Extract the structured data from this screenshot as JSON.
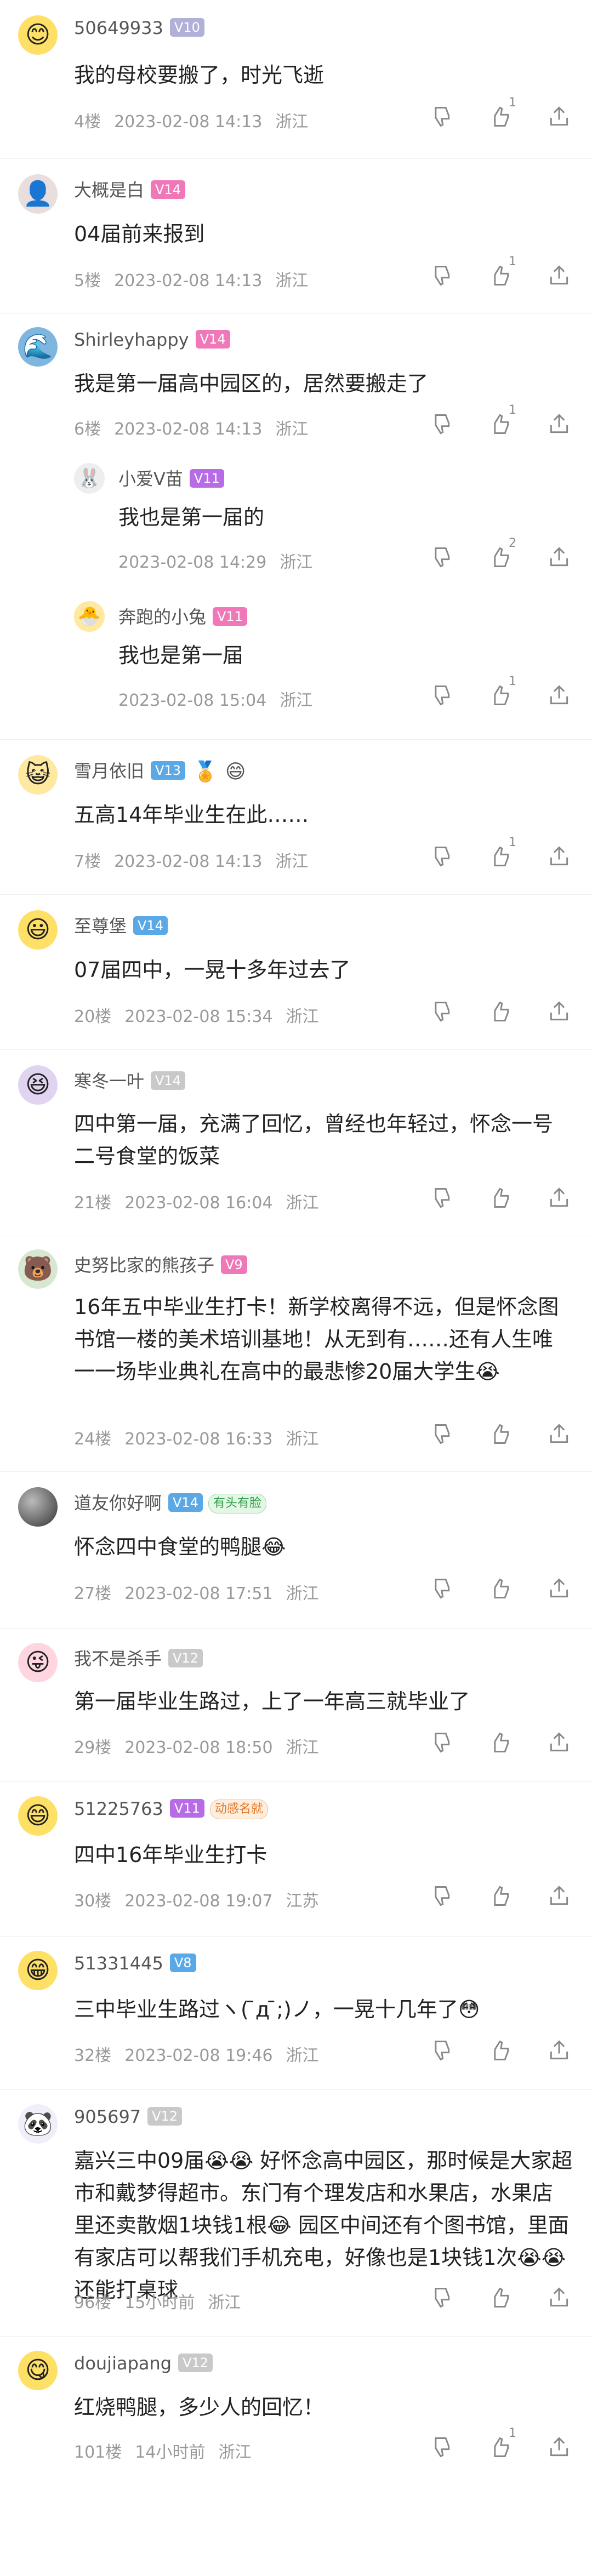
{
  "colors": {
    "v_blue": "#5aa9e6",
    "v_purple": "#b76be6",
    "v_gray": "#c9c9c9",
    "v_pink": "#f077b8"
  },
  "comments": [
    {
      "user": "50649933",
      "level": "V10",
      "text": "我的母校要搬了，时光飞逝",
      "floor": "4楼",
      "time": "2023-02-08 14:13",
      "location": "浙江",
      "likes": "1",
      "avatar": "face-icon"
    },
    {
      "user": "大概是白",
      "level": "V14",
      "text": "04届前来报到",
      "floor": "5楼",
      "time": "2023-02-08 14:13",
      "location": "浙江",
      "likes": "1",
      "avatar": "person-icon"
    },
    {
      "user": "Shirleyhappy",
      "level": "V14",
      "text": "我是第一届高中园区的，居然要搬走了",
      "floor": "6楼",
      "time": "2023-02-08 14:13",
      "location": "浙江",
      "likes": "1",
      "avatar": "landscape-icon",
      "replies": [
        {
          "user": "小爱V苗",
          "level": "V11",
          "text": "我也是第一届的",
          "time": "2023-02-08 14:29",
          "location": "浙江",
          "likes": "2"
        },
        {
          "user": "奔跑的小兔",
          "level": "V11",
          "text": "我也是第一届",
          "time": "2023-02-08 15:04",
          "location": "浙江",
          "likes": "1"
        }
      ]
    },
    {
      "user": "雪月依旧",
      "level": "V13",
      "text": "五高14年毕业生在此……",
      "floor": "7楼",
      "time": "2023-02-08 14:13",
      "location": "浙江",
      "likes": "1",
      "avatar": "face-icon"
    },
    {
      "user": "至尊堡",
      "level": "V14",
      "text": "07届四中，一晃十多年过去了",
      "floor": "20楼",
      "time": "2023-02-08 15:34",
      "location": "浙江",
      "likes": "",
      "avatar": "face-icon"
    },
    {
      "user": "寒冬一叶",
      "level": "V14",
      "text": "四中第一届，充满了回忆，曾经也年轻过，怀念一号二号食堂的饭菜",
      "floor": "21楼",
      "time": "2023-02-08 16:04",
      "location": "浙江",
      "likes": "",
      "avatar": "face-icon"
    },
    {
      "user": "史努比家的熊孩子",
      "level": "V9",
      "text": "16年五中毕业生打卡！新学校离得不远，但是怀念图书馆一楼的美术培训基地！从无到有……还有人生唯一一场毕业典礼在高中的最悲惨20届大学生😭",
      "floor": "24楼",
      "time": "2023-02-08 16:33",
      "location": "浙江",
      "likes": "",
      "avatar": "face-icon"
    },
    {
      "user": "道友你好啊",
      "level": "V14",
      "badge": "有头有脸",
      "text": "怀念四中食堂的鸭腿😂",
      "floor": "27楼",
      "time": "2023-02-08 17:51",
      "location": "浙江",
      "likes": "",
      "avatar": "sphere-icon"
    },
    {
      "user": "我不是杀手",
      "level": "V12",
      "text": "第一届毕业生路过，上了一年高三就毕业了",
      "floor": "29楼",
      "time": "2023-02-08 18:50",
      "location": "浙江",
      "likes": "",
      "avatar": "face-icon"
    },
    {
      "user": "51225763",
      "level": "V11",
      "badge": "动感名就",
      "text": "四中16年毕业生打卡",
      "floor": "30楼",
      "time": "2023-02-08 19:07",
      "location": "江苏",
      "likes": "",
      "avatar": "face-icon"
    },
    {
      "user": "51331445",
      "level": "V8",
      "text": "三中毕业生路过ヽ( ̄д ̄;)ノ，一晃十几年了😳",
      "floor": "32楼",
      "time": "2023-02-08 19:46",
      "location": "浙江",
      "likes": "",
      "avatar": "face-icon"
    },
    {
      "user": "905697",
      "level": "V12",
      "text": "嘉兴三中09届😭😭 好怀念高中园区，那时候是大家超市和戴梦得超市。东门有个理发店和水果店，水果店里还卖散烟1块钱1根😂 园区中间还有个图书馆，里面有家店可以帮我们手机充电，好像也是1块钱1次😭😭还能打桌球",
      "floor": "96楼",
      "time": "15小时前",
      "location": "浙江",
      "likes": "",
      "avatar": "face-icon"
    },
    {
      "user": "doujiapang",
      "level": "V12",
      "text": "红烧鸭腿，多少人的回忆！",
      "floor": "101楼",
      "time": "14小时前",
      "location": "浙江",
      "likes": "1",
      "avatar": "face-icon"
    }
  ],
  "icons": {
    "dislike": "thumb-down-icon",
    "like": "thumb-up-icon",
    "share": "share-icon"
  }
}
